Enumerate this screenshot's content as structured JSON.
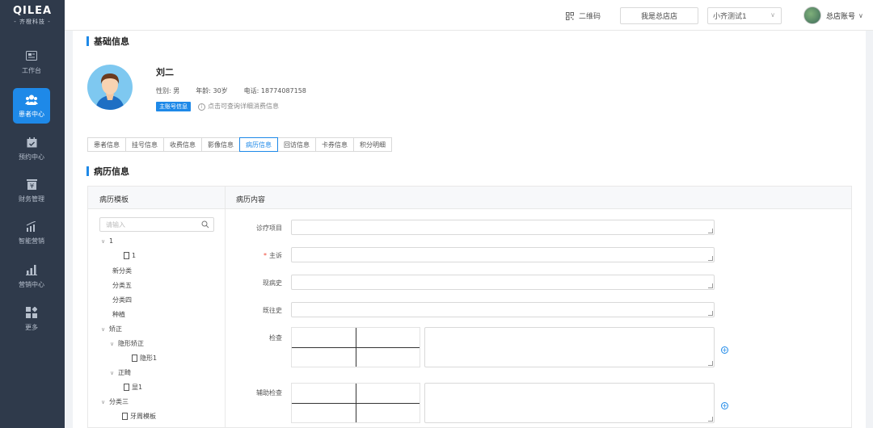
{
  "logo": {
    "mark": "QILEA",
    "sub": "- 齐橙科技 -"
  },
  "nav": [
    {
      "label": "工作台",
      "icon": "workbench-icon"
    },
    {
      "label": "患者中心",
      "icon": "patients-icon",
      "active": true
    },
    {
      "label": "预约中心",
      "icon": "calendar-icon"
    },
    {
      "label": "财务管理",
      "icon": "finance-icon"
    },
    {
      "label": "智能营销",
      "icon": "marketing-icon"
    },
    {
      "label": "营销中心",
      "icon": "bar-chart-icon"
    },
    {
      "label": "更多",
      "icon": "more-apps-icon"
    }
  ],
  "topbar": {
    "qr_label": "二维码",
    "store_button": "我是总店店",
    "clinic_select": "小齐测试1",
    "account_label": "总店账号"
  },
  "basic": {
    "section_title": "基础信息",
    "name": "刘二",
    "gender": "性别: 男",
    "age": "年龄: 30岁",
    "phone": "电话: 18774087158",
    "tag": "主账号信息",
    "hint": "点击可查询详细消费信息"
  },
  "tabs": [
    {
      "label": "患者信息"
    },
    {
      "label": "挂号信息"
    },
    {
      "label": "收费信息"
    },
    {
      "label": "影像信息"
    },
    {
      "label": "病历信息",
      "active": true
    },
    {
      "label": "回访信息"
    },
    {
      "label": "卡券信息"
    },
    {
      "label": "积分明细"
    }
  ],
  "record": {
    "section_title": "病历信息",
    "left_header": "病历模板",
    "right_header": "病历内容",
    "search_placeholder": "请输入",
    "tree": [
      {
        "label": "1",
        "caret": true,
        "level": 0
      },
      {
        "label": "1",
        "file": true,
        "level": 2
      },
      {
        "label": "新分类",
        "level": 1
      },
      {
        "label": "分类五",
        "level": 1
      },
      {
        "label": "分类四",
        "level": 1
      },
      {
        "label": "种植",
        "level": 1
      },
      {
        "label": "矫正",
        "caret": true,
        "level": 0
      },
      {
        "label": "隐形矫正",
        "caret": true,
        "level": 1
      },
      {
        "label": "隐形1",
        "file": true,
        "level": 3
      },
      {
        "label": "正畸",
        "caret": true,
        "level": 1
      },
      {
        "label": "显1",
        "file": true,
        "level": 3
      },
      {
        "label": "分类三",
        "caret": true,
        "level": 0
      },
      {
        "label": "牙周模板",
        "file": true,
        "level": 2
      }
    ],
    "fields": {
      "treatment_item": "诊疗项目",
      "chief_complaint": "主诉",
      "present_history": "现病史",
      "past_history": "既往史",
      "examination": "检查",
      "auxiliary_exam": "辅助检查"
    },
    "plus_symbol": "+"
  },
  "colors": {
    "accent": "#1e89e8",
    "sidebar": "#2f3a4b",
    "required": "#e43"
  }
}
